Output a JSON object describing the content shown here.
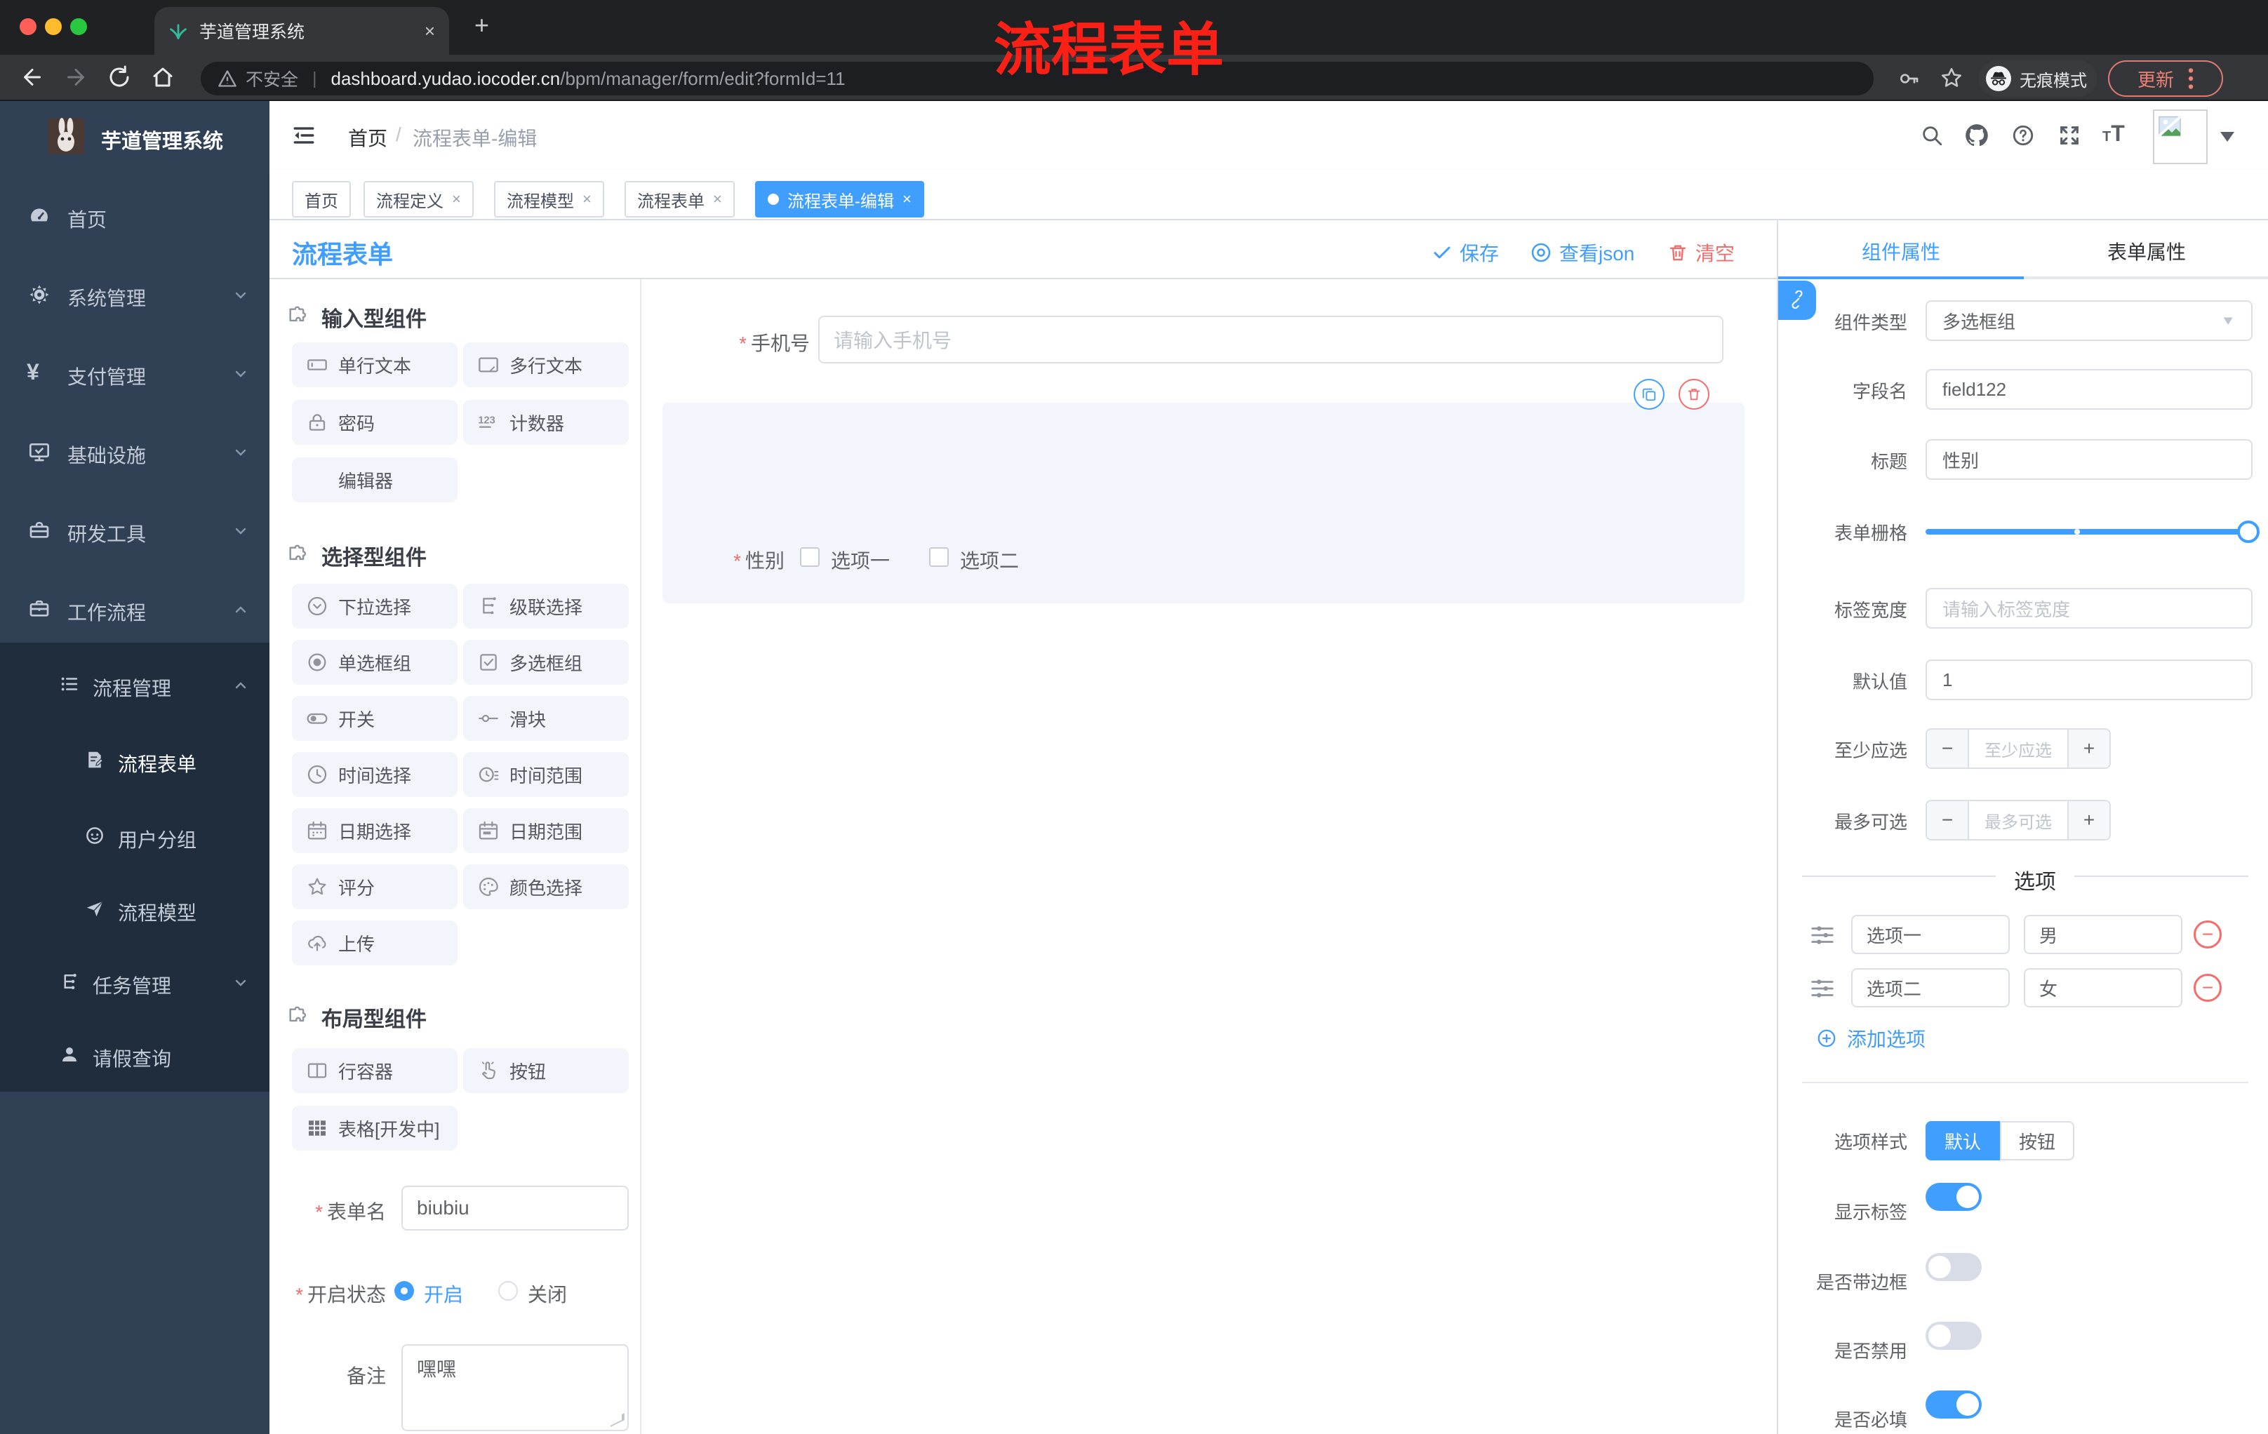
{
  "browser": {
    "tab_title": "芋道管理系统",
    "new_tab_glyph": "+",
    "close_glyph": "×",
    "security_label": "不安全",
    "url_domain": "dashboard.yudao.iocoder.cn",
    "url_path": "/bpm/manager/form/edit?formId=11",
    "incognito_label": "无痕模式",
    "update_label": "更新"
  },
  "sidebar": {
    "title": "芋道管理系统",
    "items": [
      {
        "label": "首页"
      },
      {
        "label": "系统管理"
      },
      {
        "label": "支付管理"
      },
      {
        "label": "基础设施"
      },
      {
        "label": "研发工具"
      },
      {
        "label": "工作流程"
      }
    ],
    "submenu": {
      "group": "流程管理",
      "children": [
        {
          "label": "流程表单"
        },
        {
          "label": "用户分组"
        },
        {
          "label": "流程模型"
        }
      ],
      "siblings": [
        {
          "label": "任务管理"
        },
        {
          "label": "请假查询"
        }
      ]
    }
  },
  "header": {
    "breadcrumb_home": "首页",
    "breadcrumb_sep": "/",
    "breadcrumb_current": "流程表单-编辑",
    "annotation": "流程表单"
  },
  "tabs_bar": {
    "close_glyph": "×",
    "tabs": [
      {
        "label": "首页"
      },
      {
        "label": "流程定义"
      },
      {
        "label": "流程模型"
      },
      {
        "label": "流程表单"
      },
      {
        "label": "流程表单-编辑"
      }
    ]
  },
  "designer": {
    "title": "流程表单",
    "save_label": "保存",
    "view_json_label": "查看json",
    "clear_label": "清空",
    "sections": [
      {
        "title": "输入型组件",
        "items": [
          {
            "label": "单行文本"
          },
          {
            "label": "多行文本"
          },
          {
            "label": "密码"
          },
          {
            "label": "计数器"
          },
          {
            "label": "编辑器"
          }
        ]
      },
      {
        "title": "选择型组件",
        "items": [
          {
            "label": "下拉选择"
          },
          {
            "label": "级联选择"
          },
          {
            "label": "单选框组"
          },
          {
            "label": "多选框组"
          },
          {
            "label": "开关"
          },
          {
            "label": "滑块"
          },
          {
            "label": "时间选择"
          },
          {
            "label": "时间范围"
          },
          {
            "label": "日期选择"
          },
          {
            "label": "日期范围"
          },
          {
            "label": "评分"
          },
          {
            "label": "颜色选择"
          },
          {
            "label": "上传"
          }
        ]
      },
      {
        "title": "布局型组件",
        "items": [
          {
            "label": "行容器"
          },
          {
            "label": "按钮"
          },
          {
            "label": "表格[开发中]"
          }
        ]
      }
    ],
    "form_meta": {
      "name_label": "表单名",
      "name_value": "biubiu",
      "status_label": "开启状态",
      "status_on": "开启",
      "status_off": "关闭",
      "remark_label": "备注",
      "remark_value": "嘿嘿"
    },
    "canvas": {
      "phone_label": "手机号",
      "phone_placeholder": "请输入手机号",
      "gender_label": "性别",
      "gender_options": [
        "选项一",
        "选项二"
      ]
    }
  },
  "panel": {
    "tab_component": "组件属性",
    "tab_form": "表单属性",
    "stepper_minus": "−",
    "stepper_plus": "+",
    "rows": {
      "component_type": {
        "label": "组件类型",
        "value": "多选框组"
      },
      "field_name": {
        "label": "字段名",
        "value": "field122"
      },
      "title": {
        "label": "标题",
        "value": "性别"
      },
      "grid": {
        "label": "表单栅格"
      },
      "label_width": {
        "label": "标签宽度",
        "placeholder": "请输入标签宽度"
      },
      "default_value": {
        "label": "默认值",
        "value": "1"
      },
      "min_select": {
        "label": "至少应选",
        "placeholder": "至少应选"
      },
      "max_select": {
        "label": "最多可选",
        "placeholder": "最多可选"
      }
    },
    "options_section": {
      "title": "选项",
      "options": [
        {
          "label": "选项一",
          "value": "男"
        },
        {
          "label": "选项二",
          "value": "女"
        }
      ],
      "add_label": "添加选项"
    },
    "style_row": {
      "label": "选项样式",
      "choices": [
        "默认",
        "按钮"
      ],
      "selected": "默认"
    },
    "switch_rows": [
      {
        "label": "显示标签",
        "on": true
      },
      {
        "label": "是否带边框",
        "on": false
      },
      {
        "label": "是否禁用",
        "on": false
      },
      {
        "label": "是否必填",
        "on": true
      }
    ]
  },
  "colors": {
    "accent": "#409eff",
    "danger": "#f56c6c",
    "annotation_red": "#fb2016",
    "sidebar_bg": "#304156",
    "submenu_bg": "#1f2d3d",
    "chrome_bg": "#35363a"
  }
}
